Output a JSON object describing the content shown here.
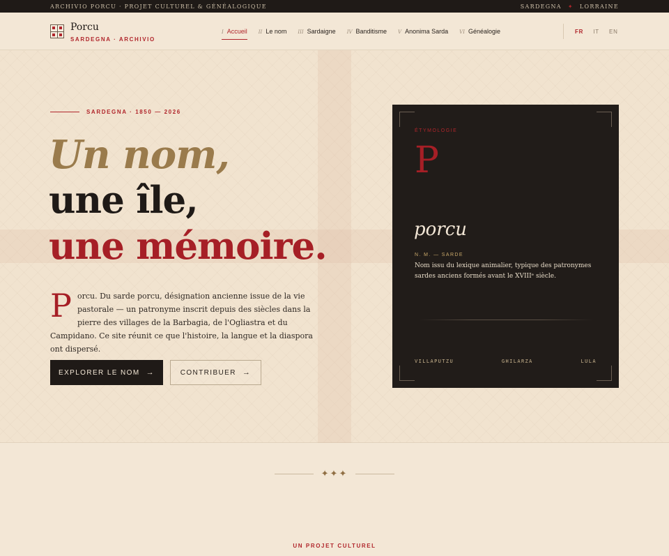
{
  "topbar": {
    "left_text": "ARCHIVIO PORCU · PROJET CULTUREL & GÉNÉALOGIQUE",
    "right_a": "SARDEGNA",
    "right_sep": "✦",
    "right_b": "LORRAINE"
  },
  "header": {
    "brand": "Porcu",
    "brand_sub": "SARDEGNA · ARCHIVIO",
    "nav": [
      {
        "num": "I",
        "label": "Accueil"
      },
      {
        "num": "II",
        "label": "Le nom"
      },
      {
        "num": "III",
        "label": "Sardaigne"
      },
      {
        "num": "IV",
        "label": "Banditisme"
      },
      {
        "num": "V",
        "label": "Anonima Sarda"
      },
      {
        "num": "VI",
        "label": "Généalogie"
      }
    ],
    "langs": [
      "FR",
      "IT",
      "EN"
    ],
    "active_lang": "FR"
  },
  "hero": {
    "eyebrow": "SARDEGNA · 1850 — 2026",
    "title_line1": "Un nom,",
    "title_line2": "une île,",
    "title_line3": "une mémoire.",
    "dropcap": "P",
    "lead": "orcu. Du sarde porcu, désignation ancienne issue de la vie pastorale — un patronyme inscrit depuis des siècles dans la pierre des villages de la Barbagia, de l'Ogliastra et du Campidano. Ce site réunit ce que l'histoire, la langue et la diaspora ont dispersé.",
    "primary_button": "EXPLORER LE NOM",
    "secondary_button": "CONTRIBUER",
    "arrow": "→"
  },
  "card": {
    "label": "ÉTYMOLOGIE",
    "letter": "P",
    "word": "porcu",
    "grammar": "N. M. — SARDE",
    "definition": "Nom issu du lexique animalier, typique des patronymes sardes anciens formés avant le XVIIIᵉ siècle.",
    "places": [
      "VILLAPUTZU",
      "GHILARZA",
      "LULA"
    ]
  },
  "footer": {
    "ornament": "✦✦✦",
    "label": "UN PROJET CULTUREL"
  },
  "colors": {
    "accent_red": "#a61f26",
    "gold": "#9a7b4c",
    "ink": "#1f1a17",
    "paper": "#f3e7d6"
  }
}
